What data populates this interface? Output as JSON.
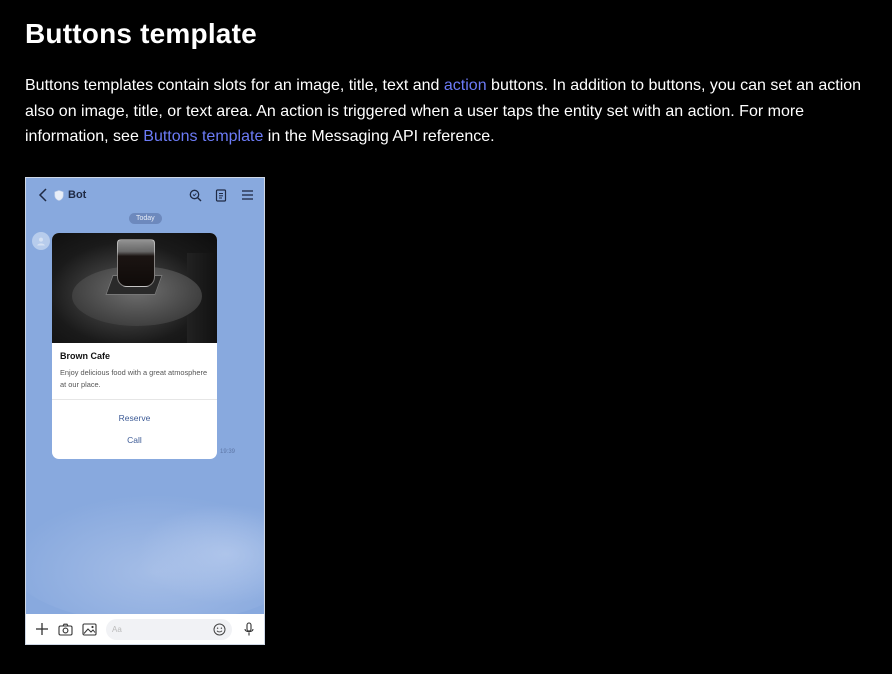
{
  "page": {
    "title": "Buttons template",
    "intro": {
      "part1": "Buttons templates contain slots for an image, title, text and ",
      "link1": "action",
      "part2": " buttons. In addition to buttons, you can set an action also on image, title, or text area. An action is triggered when a user taps the entity set with an action. For more information, see ",
      "link2": "Buttons template",
      "part3": " in the Messaging API reference."
    },
    "link_color": "#6c7bf6"
  },
  "phone": {
    "header": {
      "bot_name": "Bot",
      "icons": [
        "back-icon",
        "shield-icon",
        "search-icon",
        "notes-icon",
        "menu-icon"
      ]
    },
    "date_label": "Today",
    "card": {
      "title": "Brown Cafe",
      "text": "Enjoy delicious food with a great atmosphere at our place.",
      "buttons": [
        "Reserve",
        "Call"
      ]
    },
    "time": "19:39",
    "input": {
      "placeholder": "Aa",
      "icons": [
        "plus-icon",
        "camera-icon",
        "image-icon",
        "emoji-icon",
        "mic-icon"
      ]
    },
    "bg_color": "#88a9de",
    "accent": "#3d5b96"
  }
}
